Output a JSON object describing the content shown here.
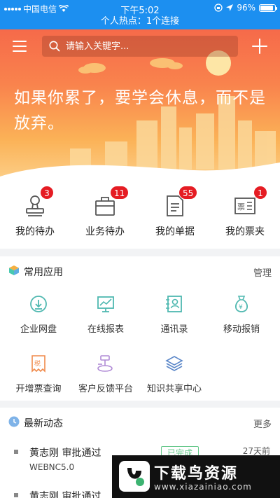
{
  "status_bar": {
    "carrier": "中国电信",
    "time": "下午5:02",
    "battery": "96%",
    "hotspot": "个人热点：1个连接"
  },
  "header": {
    "search_placeholder": "请输入关键字..."
  },
  "banner": {
    "motto": "如果你累了，要学会休息，而不是放弃。"
  },
  "quick_tasks": [
    {
      "label": "我的待办",
      "badge": "3",
      "icon": "stamp-icon"
    },
    {
      "label": "业务待办",
      "badge": "11",
      "icon": "briefcase-icon"
    },
    {
      "label": "我的单据",
      "badge": "55",
      "icon": "document-icon"
    },
    {
      "label": "我的票夹",
      "badge": "1",
      "icon": "ticket-icon"
    }
  ],
  "apps": {
    "title": "常用应用",
    "manage": "管理",
    "items": [
      {
        "label": "企业网盘",
        "icon": "cloud-download-icon"
      },
      {
        "label": "在线报表",
        "icon": "chart-board-icon"
      },
      {
        "label": "通讯录",
        "icon": "contacts-icon"
      },
      {
        "label": "移动报销",
        "icon": "money-bag-icon"
      },
      {
        "label": "开增票查询",
        "icon": "tax-invoice-icon"
      },
      {
        "label": "客户反馈平台",
        "icon": "feedback-icon"
      },
      {
        "label": "知识共享中心",
        "icon": "knowledge-stack-icon"
      }
    ]
  },
  "news": {
    "title": "最新动态",
    "more": "更多",
    "items": [
      {
        "title": "黄志刚 审批通过",
        "sub": "WEBNC5.0",
        "tag": "已完成",
        "time": "27天前"
      },
      {
        "title": "黄志刚 审批通过",
        "sub": "",
        "tag": "",
        "time": ""
      }
    ]
  },
  "watermark": {
    "title": "下载鸟资源",
    "url": "www.xiazainiao.com"
  },
  "colors": {
    "primary": "#1c8ff0",
    "badge": "#e51c23",
    "app_teal": "#4fb8b0",
    "app_orange": "#f08a4b",
    "app_purple": "#b18cd6",
    "app_blue": "#5a86c8",
    "tag_green": "#66c88b"
  }
}
